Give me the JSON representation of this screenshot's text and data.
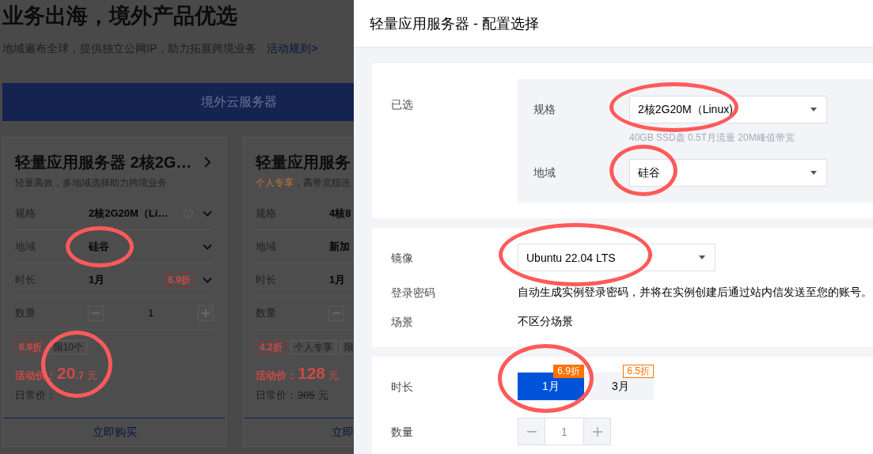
{
  "page": {
    "title": "业务出海，境外产品优选",
    "subtitle": "地域遍布全球，提供独立公网IP，助力拓展跨境业务",
    "rules_link": "活动规则>",
    "category_tab": "境外云服务器"
  },
  "cards": [
    {
      "cut": false,
      "title": "轻量应用服务器 2核2G…",
      "subtitle": [
        {
          "kind": "plain",
          "text": "轻量高效，多地域选择助力跨境业务"
        }
      ],
      "rows": [
        {
          "kind": "select",
          "label": "规格",
          "value": "2核2G20M（Li…",
          "info": true,
          "circled": false
        },
        {
          "kind": "select",
          "label": "地域",
          "value": "硅谷",
          "info": false,
          "circled": true
        },
        {
          "kind": "select",
          "label": "时长",
          "value": "1月",
          "discount": "6.9折",
          "info": false,
          "circled": false
        },
        {
          "kind": "stepper",
          "label": "数量",
          "value": "1",
          "info": false,
          "circled": false
        }
      ],
      "tags": [
        {
          "kind": "discount",
          "text": "6.9折"
        },
        {
          "kind": "plain",
          "text": "限10个"
        }
      ],
      "price": {
        "label": "活动价：",
        "amount": "20",
        "fraction": ".7",
        "unit": "元",
        "circled": true
      },
      "regular_price": {
        "label": "日常价："
      },
      "buy_button": "立即购买"
    },
    {
      "cut": true,
      "title": "轻量应用服务",
      "subtitle": [
        {
          "kind": "accent",
          "text": "个人专享"
        },
        {
          "kind": "plain",
          "text": "，高带宽稳连"
        }
      ],
      "rows": [
        {
          "kind": "select",
          "label": "规格",
          "value": "4核8",
          "info": false,
          "circled": false
        },
        {
          "kind": "select",
          "label": "地域",
          "value": "新加",
          "info": false,
          "circled": false
        },
        {
          "kind": "select",
          "label": "时长",
          "value": "1月",
          "info": false,
          "circled": false
        },
        {
          "kind": "stepper",
          "label": "数量",
          "info": false,
          "circled": false
        }
      ],
      "tags": [
        {
          "kind": "discount",
          "text": "4.2折"
        },
        {
          "kind": "plain",
          "text": "个人专享"
        },
        {
          "kind": "plain",
          "text": "限"
        }
      ],
      "price": {
        "label": "活动价：",
        "amount": "128",
        "unit": "元",
        "circled": false
      },
      "regular_price": {
        "label": "日常价：",
        "amount": "305",
        "unit": "元"
      },
      "buy_button": "立即"
    }
  ],
  "drawer": {
    "title": "轻量应用服务器 - 配置选择",
    "selected": {
      "label": "已选",
      "fields": [
        {
          "label": "规格",
          "value": "2核2G20M（Linux)",
          "hint": "40GB SSD盘 0.5T月流量 20M峰值带宽",
          "circled": true
        },
        {
          "label": "地域",
          "value": "硅谷",
          "circled": true
        }
      ]
    },
    "image": {
      "rows": [
        {
          "kind": "select",
          "label": "镜像",
          "value": "Ubuntu 22.04 LTS",
          "circled": true
        },
        {
          "kind": "text",
          "label": "登录密码",
          "value": "自动生成实例登录密码，并将在实例创建后通过站内信发送至您的账号。",
          "circled": false
        },
        {
          "kind": "text",
          "label": "场景",
          "value": "不区分场景",
          "circled": false
        }
      ]
    },
    "duration": {
      "label": "时长",
      "options": [
        {
          "label": "1月",
          "badge": "6.9折",
          "selected": true,
          "circled": true
        },
        {
          "label": "3月",
          "badge": "6.5折",
          "selected": false,
          "circled": false
        }
      ]
    },
    "quantity": {
      "label": "数量",
      "value": "1"
    }
  }
}
